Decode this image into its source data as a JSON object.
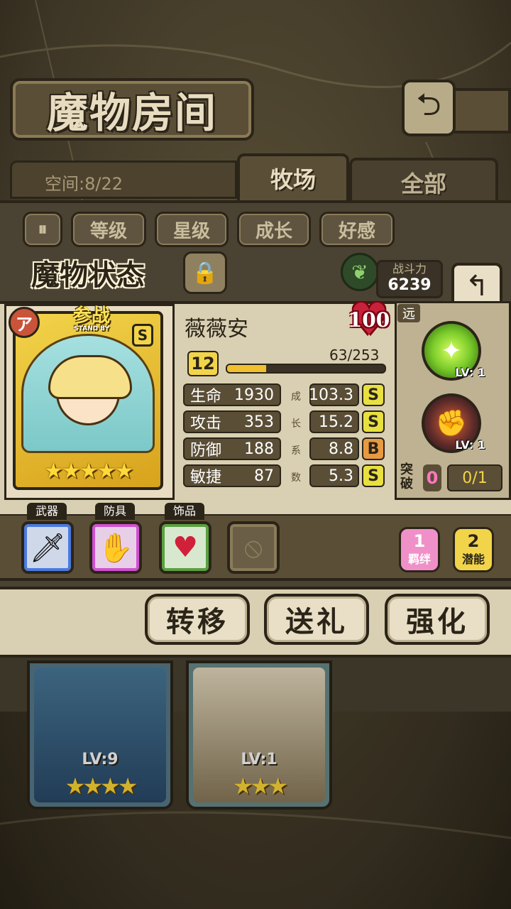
{
  "header": {
    "title": "魔物房间",
    "back_icon": "return-arrow-icon",
    "space_label": "空间:8/22"
  },
  "tabs": [
    {
      "label": "牧场",
      "active": true
    },
    {
      "label": "全部",
      "active": false
    }
  ],
  "filters": {
    "toggle_icon": "pause-sort-icon",
    "buttons": [
      "等级",
      "星级",
      "成长",
      "好感"
    ]
  },
  "status": {
    "title": "魔物状态",
    "lock_icon": "padlock-icon",
    "element_icon": "leaf-icon",
    "power_label": "战斗力",
    "power_value": "6239",
    "back_icon": "return-arrow-icon"
  },
  "monster": {
    "name": "薇薇安",
    "affection": "100",
    "standby_label": "参战",
    "standby_sub": "STAND BY",
    "rank": "S",
    "side_badge": "ア",
    "stars": 5,
    "level": "12",
    "exp_text": "63/253",
    "exp_fraction": 0.249,
    "stats": [
      {
        "label": "生命",
        "value": "1930",
        "growth": "103.3",
        "grade": "S"
      },
      {
        "label": "攻击",
        "value": "353",
        "growth": "15.2",
        "grade": "S"
      },
      {
        "label": "防御",
        "value": "188",
        "growth": "8.8",
        "grade": "B"
      },
      {
        "label": "敏捷",
        "value": "87",
        "growth": "5.3",
        "grade": "S"
      }
    ],
    "growth_label": [
      "成",
      "长",
      "系",
      "数"
    ]
  },
  "skills": {
    "range": "远",
    "items": [
      {
        "icon": "light-burst-icon",
        "lv": "LV: 1",
        "color": "#7acb2a"
      },
      {
        "icon": "fist-strike-icon",
        "lv": "LV: 1",
        "color": "#5a2a2a"
      }
    ],
    "break_label": "突破",
    "break_value": "0",
    "break_ratio": "0/1"
  },
  "equipment": {
    "tags": [
      "武器",
      "防具",
      "饰品"
    ],
    "slots": [
      {
        "icon": "sword-icon",
        "border": "#4a7ae0"
      },
      {
        "icon": "gauntlet-icon",
        "border": "#d050d0"
      },
      {
        "icon": "heart-gem-icon",
        "border": "#5aa040"
      },
      {
        "icon": "empty-slot-icon",
        "border": "#8a7b5a"
      }
    ],
    "bond": {
      "count": "1",
      "label": "羁绊"
    },
    "potential": {
      "count": "2",
      "label": "潜能"
    }
  },
  "actions": [
    "转移",
    "送礼",
    "强化"
  ],
  "roster": [
    {
      "lv": "LV:9",
      "stars": 4
    },
    {
      "lv": "LV:1",
      "stars": 3
    }
  ]
}
